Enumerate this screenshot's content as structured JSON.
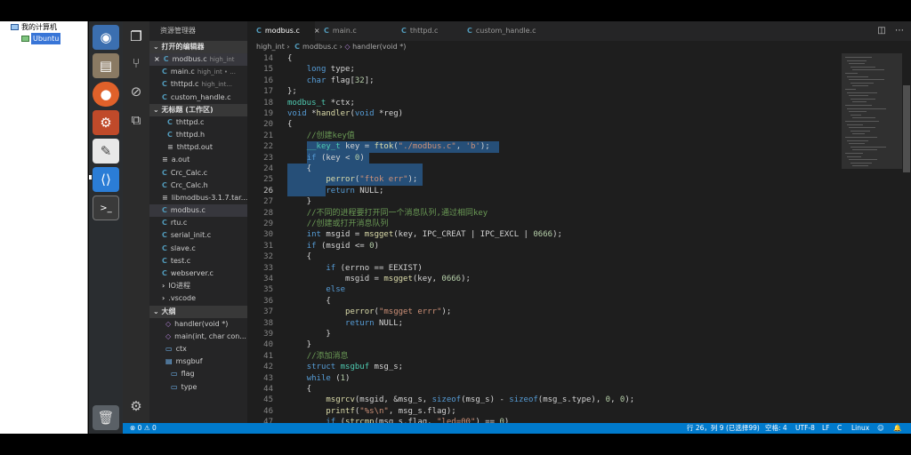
{
  "vm_tree": {
    "root": "我的计算机",
    "vm": "Ubuntu"
  },
  "launcher": {
    "items": [
      "ubuntu-dash",
      "files",
      "firefox",
      "system-settings",
      "text-editor",
      "vscode",
      "terminal",
      "trash"
    ]
  },
  "explorer": {
    "title": "资源管理器",
    "open_editors_header": "打开的编辑器",
    "open_editors": [
      {
        "name": "modbus.c",
        "detail": "high_int",
        "close": "×"
      },
      {
        "name": "main.c",
        "detail": "high_int • ..."
      },
      {
        "name": "thttpd.c",
        "detail": "high_int..."
      },
      {
        "name": "custom_handle.c",
        "detail": ""
      }
    ],
    "workspace_header": "无标题 (工作区)",
    "files": [
      {
        "icon": "C",
        "name": "thttpd.c"
      },
      {
        "icon": "C",
        "name": "thttpd.h"
      },
      {
        "icon": "≡",
        "name": "thttpd.out"
      },
      {
        "icon": "≡",
        "name": "a.out"
      },
      {
        "icon": "C",
        "name": "Crc_Calc.c"
      },
      {
        "icon": "C",
        "name": "Crc_Calc.h"
      },
      {
        "icon": "≡",
        "name": "libmodbus-3.1.7.tar..."
      },
      {
        "icon": "C",
        "name": "modbus.c"
      },
      {
        "icon": "C",
        "name": "rtu.c"
      },
      {
        "icon": "C",
        "name": "serial_init.c"
      },
      {
        "icon": "C",
        "name": "slave.c"
      },
      {
        "icon": "C",
        "name": "test.c"
      },
      {
        "icon": "C",
        "name": "webserver.c"
      },
      {
        "icon": "›",
        "name": "IO进程"
      },
      {
        "icon": "›",
        "name": ".vscode"
      }
    ],
    "outline_header": "大纲",
    "outline": [
      {
        "icon": "◇",
        "name": "handler(void *)"
      },
      {
        "icon": "◇",
        "name": "main(int, char con..."
      },
      {
        "icon": "▭",
        "name": "ctx"
      },
      {
        "icon": "▤",
        "name": "msgbuf"
      },
      {
        "icon": "▭",
        "name": "flag"
      },
      {
        "icon": "▭",
        "name": "type"
      }
    ]
  },
  "tabs": [
    {
      "label": "modbus.c",
      "active": true,
      "close": "×"
    },
    {
      "label": "main.c"
    },
    {
      "label": "thttpd.c"
    },
    {
      "label": "custom_handle.c"
    }
  ],
  "breadcrumb": {
    "folder": "high_int",
    "sep1": "›",
    "file": "modbus.c",
    "sep2": "›",
    "symbol": "handler(void *)"
  },
  "editor": {
    "cursor_line": 26,
    "lines": [
      {
        "n": "14",
        "t": "{"
      },
      {
        "n": "15",
        "t": "    long type;"
      },
      {
        "n": "16",
        "t": "    char flag[32];"
      },
      {
        "n": "17",
        "t": "};"
      },
      {
        "n": "18",
        "t": "modbus_t *ctx;"
      },
      {
        "n": "19",
        "t": "void *handler(void *reg)"
      },
      {
        "n": "20",
        "t": "{"
      },
      {
        "n": "21",
        "t": "    //创建key值"
      },
      {
        "n": "22",
        "t": "    __key_t key = ftok(\"./modbus.c\", 'b');"
      },
      {
        "n": "23",
        "t": "    if (key < 0)"
      },
      {
        "n": "24",
        "t": "    {"
      },
      {
        "n": "25",
        "t": "        perror(\"ftok err\");"
      },
      {
        "n": "26",
        "t": "        return NULL;"
      },
      {
        "n": "27",
        "t": "    }"
      },
      {
        "n": "28",
        "t": "    //不同的进程要打开同一个消息队列,通过相同key"
      },
      {
        "n": "29",
        "t": "    //创建或打开消息队列"
      },
      {
        "n": "30",
        "t": "    int msgid = msgget(key, IPC_CREAT | IPC_EXCL | 0666);"
      },
      {
        "n": "31",
        "t": "    if (msgid <= 0)"
      },
      {
        "n": "32",
        "t": "    {"
      },
      {
        "n": "33",
        "t": "        if (errno == EEXIST)"
      },
      {
        "n": "34",
        "t": "            msgid = msgget(key, 0666);"
      },
      {
        "n": "35",
        "t": "        else"
      },
      {
        "n": "36",
        "t": "        {"
      },
      {
        "n": "37",
        "t": "            perror(\"msgget errr\");"
      },
      {
        "n": "38",
        "t": "            return NULL;"
      },
      {
        "n": "39",
        "t": "        }"
      },
      {
        "n": "40",
        "t": "    }"
      },
      {
        "n": "41",
        "t": "    //添加消息"
      },
      {
        "n": "42",
        "t": "    struct msgbuf msg_s;"
      },
      {
        "n": "43",
        "t": "    while (1)"
      },
      {
        "n": "44",
        "t": "    {"
      },
      {
        "n": "45",
        "t": "        msgrcv(msgid, &msg_s, sizeof(msg_s) - sizeof(msg_s.type), 0, 0);"
      },
      {
        "n": "46",
        "t": "        printf(\"%s\\n\", msg_s.flag);"
      },
      {
        "n": "47",
        "t": "        if (strcmp(msg_s.flag, \"led=00\") == 0)"
      }
    ]
  },
  "statusbar": {
    "errors": "⊗ 0",
    "warnings": "⚠ 0",
    "position": "行 26，列 9 (已选择99)",
    "spaces": "空格: 4",
    "encoding": "UTF-8",
    "eol": "LF",
    "language": "C",
    "platform": "Linux"
  },
  "colors": {
    "statusbar": "#007acc",
    "selection": "#264f78",
    "editor_bg": "#1e1e1e"
  }
}
